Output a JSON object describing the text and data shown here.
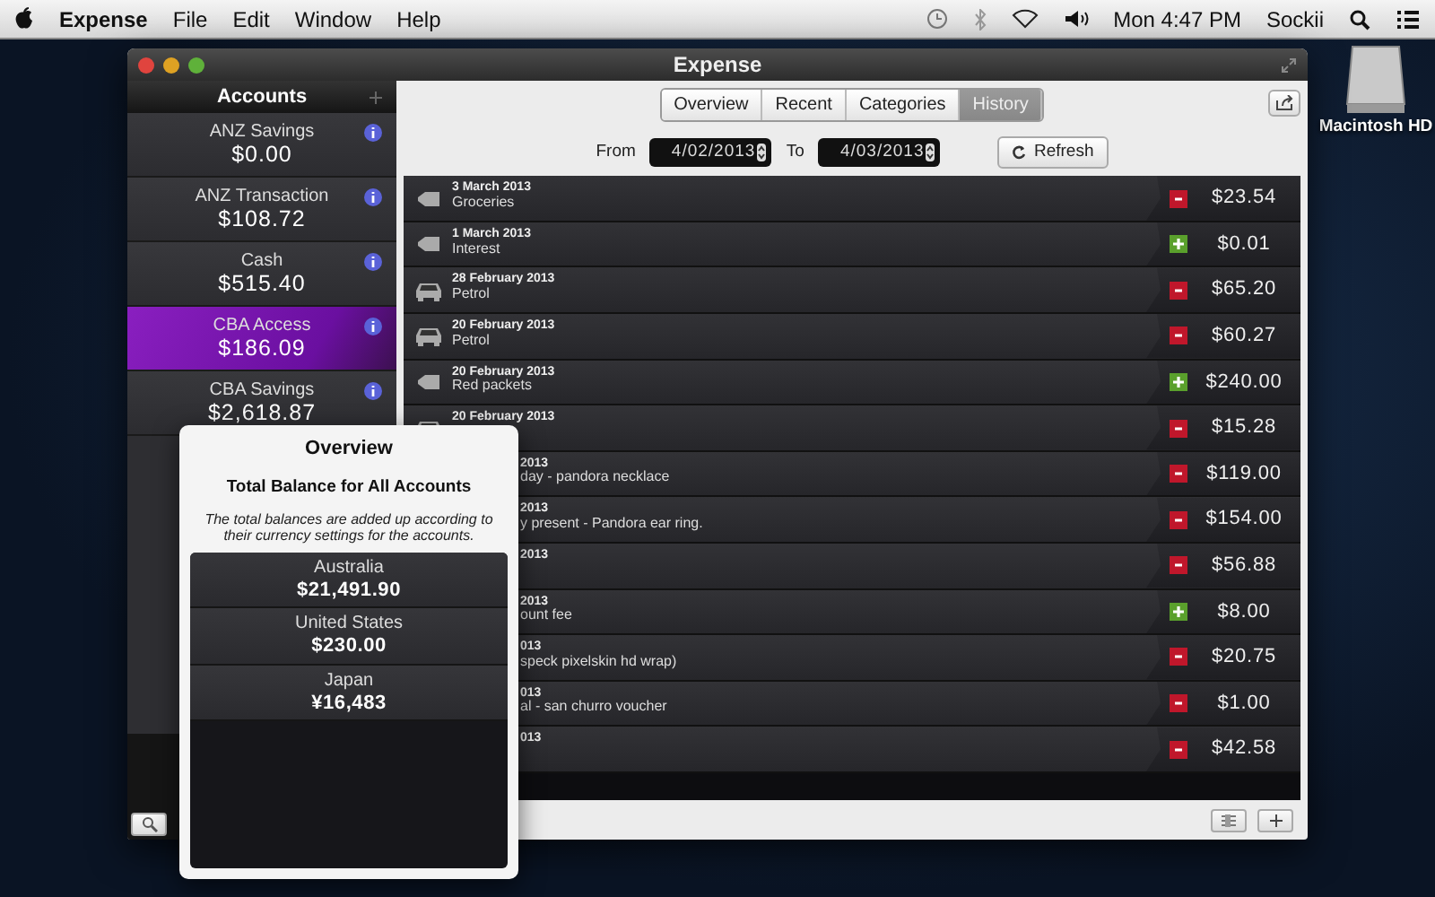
{
  "menu_bar": {
    "app": "Expense",
    "items": [
      "File",
      "Edit",
      "Window",
      "Help"
    ],
    "clock": "Mon 4:47 PM",
    "user": "Sockii"
  },
  "desktop": {
    "drive_label": "Macintosh HD"
  },
  "window": {
    "title": "Expense"
  },
  "sidebar": {
    "title": "Accounts",
    "accounts": [
      {
        "name": "ANZ Savings",
        "balance": "$0.00",
        "selected": false
      },
      {
        "name": "ANZ Transaction",
        "balance": "$108.72",
        "selected": false
      },
      {
        "name": "Cash",
        "balance": "$515.40",
        "selected": false
      },
      {
        "name": "CBA Access",
        "balance": "$186.09",
        "selected": true
      },
      {
        "name": "CBA Savings",
        "balance": "$2,618.87",
        "selected": false
      }
    ]
  },
  "tabs": [
    {
      "label": "Overview",
      "selected": false
    },
    {
      "label": "Recent",
      "selected": false
    },
    {
      "label": "Categories",
      "selected": false
    },
    {
      "label": "History",
      "selected": true
    }
  ],
  "filter": {
    "from_label": "From",
    "from": "4/02/2013",
    "to_label": "To",
    "to": "4/03/2013",
    "refresh": "Refresh"
  },
  "transactions": [
    {
      "kind": "tag",
      "date": "3 March 2013",
      "description": "Groceries",
      "credit": false,
      "amount": "$23.54"
    },
    {
      "kind": "tag",
      "date": "1 March 2013",
      "description": "Interest",
      "credit": true,
      "amount": "$0.01"
    },
    {
      "kind": "car",
      "date": "28 February 2013",
      "description": "Petrol",
      "credit": false,
      "amount": "$65.20"
    },
    {
      "kind": "car",
      "date": "20 February 2013",
      "description": "Petrol",
      "credit": false,
      "amount": "$60.27"
    },
    {
      "kind": "tag",
      "date": "20 February 2013",
      "description": "Red packets",
      "credit": true,
      "amount": "$240.00"
    },
    {
      "kind": "car",
      "date": "20 February 2013",
      "credit": false,
      "amount": "$15.28"
    },
    {
      "kind": "covered",
      "date": "2013",
      "description": "day - pandora necklace",
      "credit": false,
      "amount": "$119.00"
    },
    {
      "kind": "covered",
      "date": "2013",
      "description": "y present - Pandora ear ring.",
      "credit": false,
      "amount": "$154.00"
    },
    {
      "kind": "covered",
      "date": "2013",
      "credit": false,
      "amount": "$56.88"
    },
    {
      "kind": "covered",
      "date": "2013",
      "description": "ount fee",
      "credit": true,
      "amount": "$8.00"
    },
    {
      "kind": "covered",
      "date": "013",
      "description": "speck pixelskin hd wrap)",
      "credit": false,
      "amount": "$20.75"
    },
    {
      "kind": "covered",
      "date": "013",
      "description": "al - san churro voucher",
      "credit": false,
      "amount": "$1.00"
    },
    {
      "kind": "covered",
      "date": "013",
      "credit": false,
      "amount": "$42.58"
    }
  ],
  "popover": {
    "title": "Overview",
    "subtitle": "Total Balance for All Accounts",
    "note": "The total balances are added up according to their currency settings for the accounts.",
    "totals": [
      {
        "country": "Australia",
        "amount": "$21,491.90"
      },
      {
        "country": "United States",
        "amount": "$230.00"
      },
      {
        "country": "Japan",
        "amount": "¥16,483"
      }
    ]
  }
}
